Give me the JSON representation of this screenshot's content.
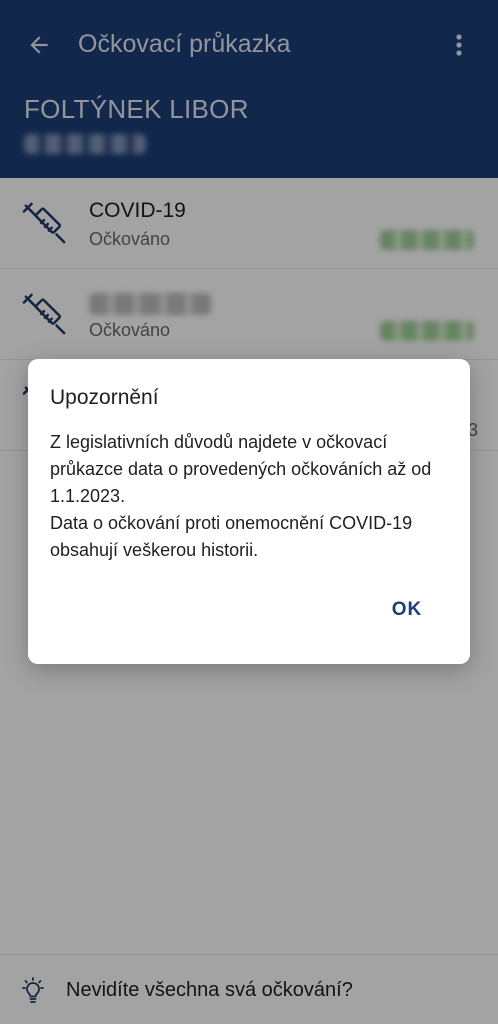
{
  "colors": {
    "primary": "#1d3d78",
    "accent_green": "#9fcf97",
    "scrim": "rgba(0,0,0,0.36)"
  },
  "header": {
    "back_icon": "arrow-left-icon",
    "title": "Očkovací průkazka",
    "menu_icon": "more-vert-icon",
    "person_name": "FOLTÝNEK LIBOR"
  },
  "vaccinations": [
    {
      "icon": "syringe-icon",
      "name": "COVID-19",
      "status": "Očkováno"
    },
    {
      "icon": "syringe-icon",
      "name": "",
      "status": "Očkováno"
    },
    {
      "icon": "syringe-icon",
      "peek": "3"
    }
  ],
  "footer": {
    "icon": "lightbulb-icon",
    "text": "Nevidíte všechna svá očkování?"
  },
  "dialog": {
    "title": "Upozornění",
    "body_1": "Z legislativních důvodů najdete v očkovací průkazce data o provedených očkováních až od 1.1.2023.",
    "body_2": "Data o očkování proti onemocnění COVID-19 obsahují veškerou historii.",
    "ok_label": "OK"
  }
}
